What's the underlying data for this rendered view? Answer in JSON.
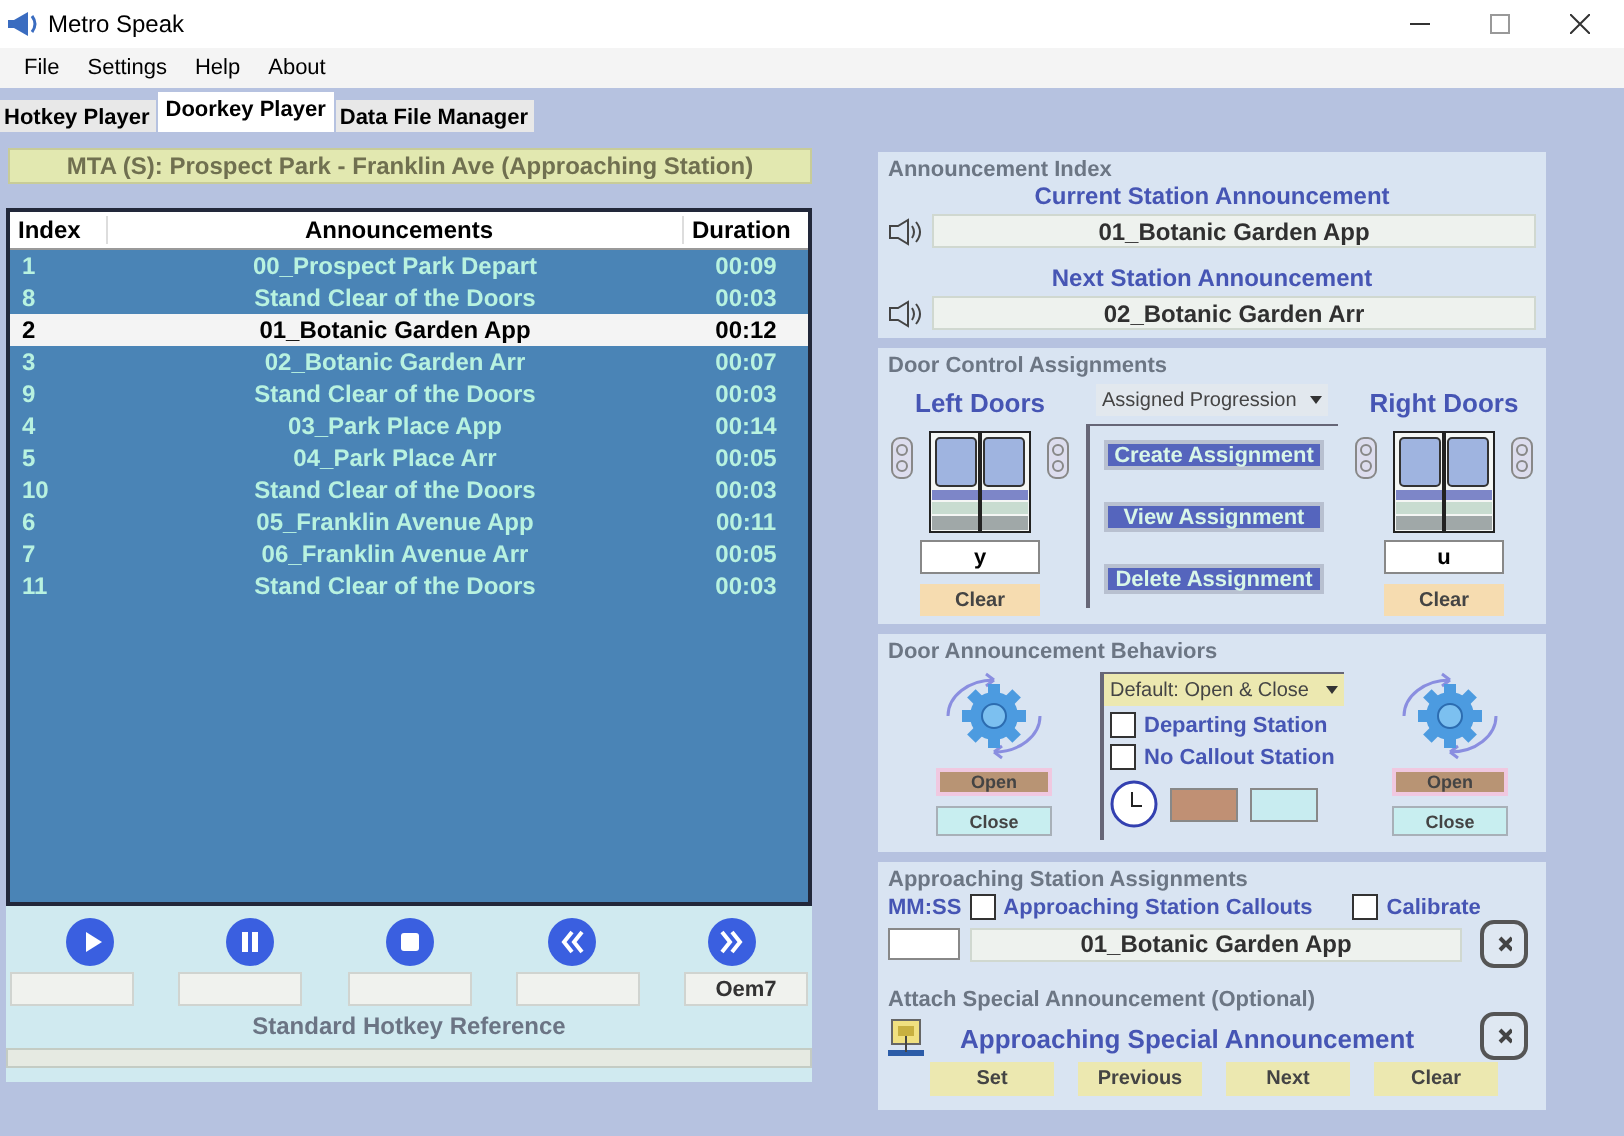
{
  "window": {
    "title": "Metro Speak"
  },
  "menu": [
    "File",
    "Settings",
    "Help",
    "About"
  ],
  "tabs": [
    {
      "label": "Hotkey Player",
      "selected": false
    },
    {
      "label": "Doorkey Player",
      "selected": true
    },
    {
      "label": "Data File Manager",
      "selected": false
    }
  ],
  "route_banner": "MTA (S): Prospect Park - Franklin Ave (Approaching Station)",
  "playlist": {
    "columns": [
      "Index",
      "Announcements",
      "Duration"
    ],
    "rows": [
      {
        "index": "1",
        "announcement": "00_Prospect Park Depart",
        "duration": "00:09",
        "selected": false
      },
      {
        "index": "8",
        "announcement": "Stand Clear of the Doors",
        "duration": "00:03",
        "selected": false
      },
      {
        "index": "2",
        "announcement": "01_Botanic Garden App",
        "duration": "00:12",
        "selected": true
      },
      {
        "index": "3",
        "announcement": "02_Botanic Garden Arr",
        "duration": "00:07",
        "selected": false
      },
      {
        "index": "9",
        "announcement": "Stand Clear of the Doors",
        "duration": "00:03",
        "selected": false
      },
      {
        "index": "4",
        "announcement": "03_Park Place App",
        "duration": "00:14",
        "selected": false
      },
      {
        "index": "5",
        "announcement": "04_Park Place Arr",
        "duration": "00:05",
        "selected": false
      },
      {
        "index": "10",
        "announcement": "Stand Clear of the Doors",
        "duration": "00:03",
        "selected": false
      },
      {
        "index": "6",
        "announcement": "05_Franklin Avenue App",
        "duration": "00:11",
        "selected": false
      },
      {
        "index": "7",
        "announcement": "06_Franklin Avenue Arr",
        "duration": "00:05",
        "selected": false
      },
      {
        "index": "11",
        "announcement": "Stand Clear of the Doors",
        "duration": "00:03",
        "selected": false
      }
    ]
  },
  "transport": [
    {
      "kind": "play"
    },
    {
      "kind": "pause"
    },
    {
      "kind": "stop"
    },
    {
      "kind": "rewind"
    },
    {
      "kind": "forward",
      "hotkey": "Oem7"
    }
  ],
  "hotkey_reference": "Standard Hotkey Reference",
  "announcement_index": {
    "title": "Announcement Index",
    "current_label": "Current Station Announcement",
    "current_value": "01_Botanic Garden App",
    "next_label": "Next Station Announcement",
    "next_value": "02_Botanic Garden Arr"
  },
  "door_control": {
    "title": "Door Control Assignments",
    "left_label": "Left Doors",
    "right_label": "Right Doors",
    "mode": "Assigned Progression",
    "left_key": "y",
    "right_key": "u",
    "left_clear": "Clear",
    "right_clear": "Clear",
    "actions": [
      "Create Assignment",
      "View Assignment",
      "Delete Assignment"
    ]
  },
  "door_behaviors": {
    "title": "Door Announcement Behaviors",
    "mode": "Default: Open & Close",
    "options": [
      {
        "label": "Departing Station",
        "checked": false
      },
      {
        "label": "No Callout Station",
        "checked": false
      }
    ],
    "left_buttons": [
      "Open",
      "Close"
    ],
    "right_buttons": [
      "Open",
      "Close"
    ],
    "swatches": [
      {
        "color": "#c09074"
      },
      {
        "color": "#c8ecf0"
      }
    ]
  },
  "approaching": {
    "title": "Approaching Station Assignments",
    "time_label": "MM:SS",
    "options": [
      {
        "label": "Approaching Station Callouts",
        "checked": false
      },
      {
        "label": "Calibrate",
        "checked": false
      }
    ],
    "value": "01_Botanic Garden App"
  },
  "special": {
    "title": "Attach Special Announcement (Optional)",
    "label": "Approaching Special Announcement",
    "buttons": [
      "Set",
      "Previous",
      "Next",
      "Clear"
    ]
  }
}
